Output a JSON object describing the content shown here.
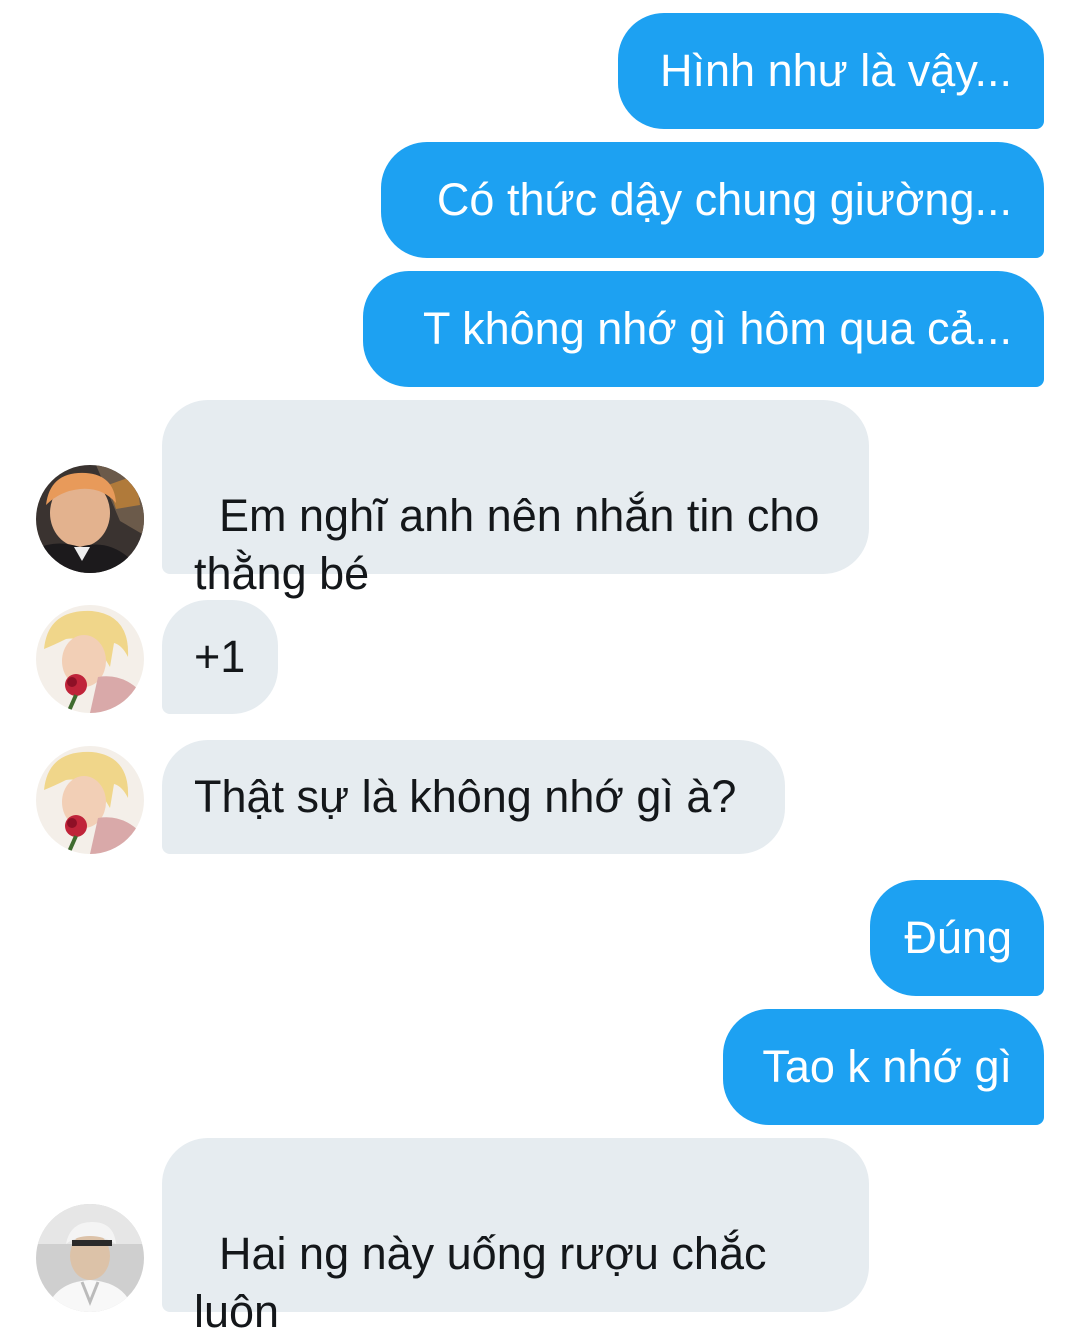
{
  "conversation": {
    "messages": [
      {
        "side": "sent",
        "text": "Hình như là vậy..."
      },
      {
        "side": "sent",
        "text": "Có thức dậy chung giường..."
      },
      {
        "side": "sent",
        "text": "T không nhớ gì hôm qua cả..."
      },
      {
        "side": "received",
        "avatar": "avatar-orange-hair",
        "text": "Em nghĩ anh nên nhắn tin cho\nthằng bé"
      },
      {
        "side": "received",
        "avatar": "avatar-blonde-rose",
        "text": "+1"
      },
      {
        "side": "received",
        "avatar": "avatar-blonde-rose",
        "text": "Thật sự là không nhớ gì à?"
      },
      {
        "side": "sent",
        "text": "Đúng"
      },
      {
        "side": "sent",
        "text": "Tao k nhớ gì"
      },
      {
        "side": "received",
        "avatar": "avatar-white-cap",
        "text": "Hai ng này uống rượu chắc\nluôn"
      }
    ]
  },
  "colors": {
    "sent_bubble": "#1da1f2",
    "received_bubble": "#e6ecf0",
    "sent_text": "#ffffff",
    "received_text": "#14171a"
  }
}
